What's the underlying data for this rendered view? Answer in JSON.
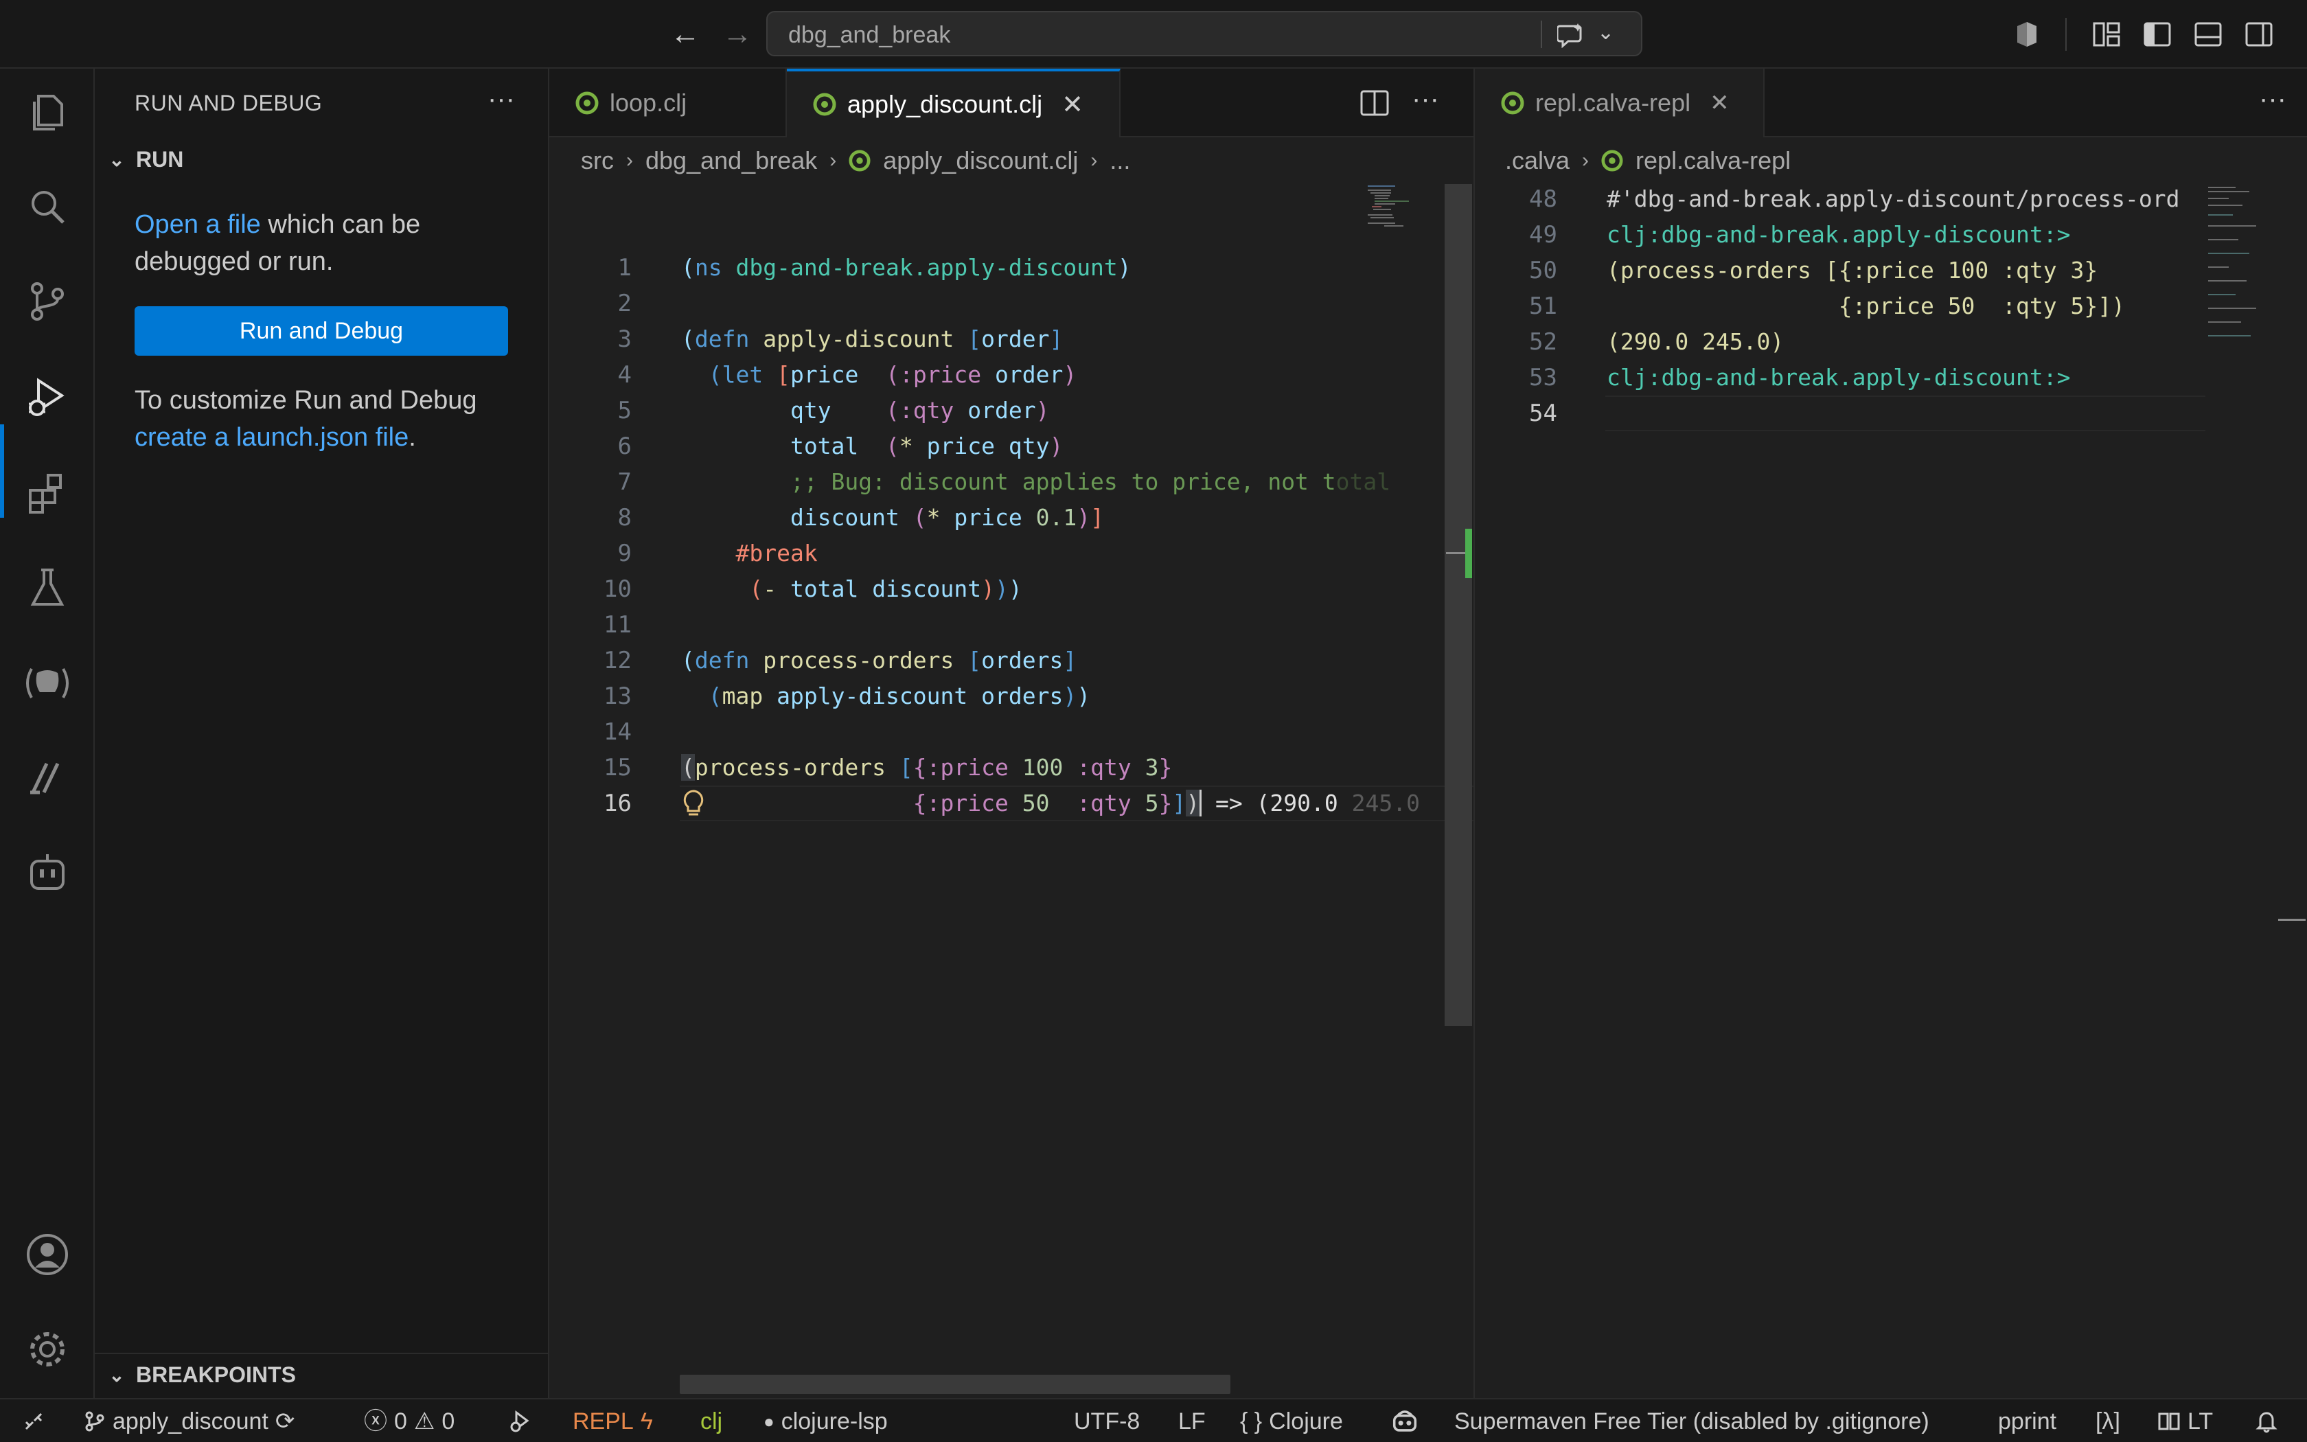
{
  "titlebar": {
    "search_label": "dbg_and_break"
  },
  "sidebar": {
    "title": "RUN AND DEBUG",
    "run_section": "RUN",
    "open_file_link": "Open a file",
    "open_file_rest": " which can be debugged or run.",
    "run_debug_button": "Run and Debug",
    "customize_text": "To customize Run and Debug",
    "launch_link": "create a launch.json file",
    "launch_period": ".",
    "breakpoints_section": "BREAKPOINTS"
  },
  "editor1": {
    "tabs": [
      {
        "label": "loop.clj",
        "active": false
      },
      {
        "label": "apply_discount.clj",
        "active": true
      }
    ],
    "breadcrumb": [
      "src",
      "dbg_and_break",
      "apply_discount.clj",
      "..."
    ],
    "line_numbers": [
      "1",
      "2",
      "3",
      "4",
      "5",
      "6",
      "7",
      "8",
      "9",
      "10",
      "11",
      "12",
      "13",
      "14",
      "15",
      "16"
    ],
    "current_line": "16",
    "inline_result": "=> (290.0 ",
    "inline_result_faded": "245.0"
  },
  "editor2": {
    "tab_label": "repl.calva-repl",
    "breadcrumb": [
      ".calva",
      "repl.calva-repl"
    ],
    "line_numbers": [
      "48",
      "49",
      "50",
      "51",
      "52",
      "53",
      "54"
    ],
    "current_line": "54",
    "lines": [
      "#'dbg-and-break.apply-discount/process-ord",
      "clj:dbg-and-break.apply-discount:>",
      "(process-orders [{:price 100 :qty 3}",
      "                 {:price 50  :qty 5}])",
      "(290.0 245.0)",
      "clj:dbg-and-break.apply-discount:>",
      ""
    ]
  },
  "statusbar": {
    "branch": "apply_discount",
    "errors": "0",
    "warnings": "0",
    "repl": "REPL",
    "clj": "clj",
    "lsp": "clojure-lsp",
    "encoding": "UTF-8",
    "eol": "LF",
    "language_braces": "{ }",
    "language": "Clojure",
    "supermaven": "Supermaven Free Tier (disabled by .gitignore)",
    "pprint": "pprint",
    "lambda": "[λ]",
    "lt": "LT"
  },
  "colors": {
    "accent": "#0078d4",
    "link": "#4daafc",
    "repl": "#e8884b",
    "clj": "#a6c83a",
    "calva_icon": "#7cb342"
  }
}
